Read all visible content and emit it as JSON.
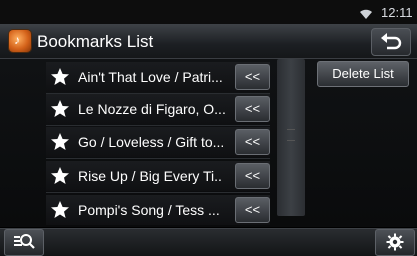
{
  "status_bar": {
    "time": "12:11"
  },
  "header": {
    "title": "Bookmarks List"
  },
  "bookmarks": [
    {
      "label": "Ain't That Love / Patri...",
      "move_label": "<<"
    },
    {
      "label": "Le Nozze di Figaro, O...",
      "move_label": "<<"
    },
    {
      "label": "Go / Loveless / Gift to...",
      "move_label": "<<"
    },
    {
      "label": "Rise Up / Big Every Ti..",
      "move_label": "<<"
    },
    {
      "label": "Pompi's Song / Tess ...",
      "move_label": "<<"
    }
  ],
  "actions": {
    "delete_list_label": "Delete List"
  },
  "colors": {
    "accent": "#d4621a",
    "background": "#000000"
  },
  "icons": {
    "status": [
      "wifi-icon"
    ],
    "header": [
      "app-icon",
      "back-icon"
    ],
    "row": [
      "star-icon",
      "move-up-icon"
    ],
    "bottom": [
      "search-icon",
      "settings-icon"
    ]
  }
}
